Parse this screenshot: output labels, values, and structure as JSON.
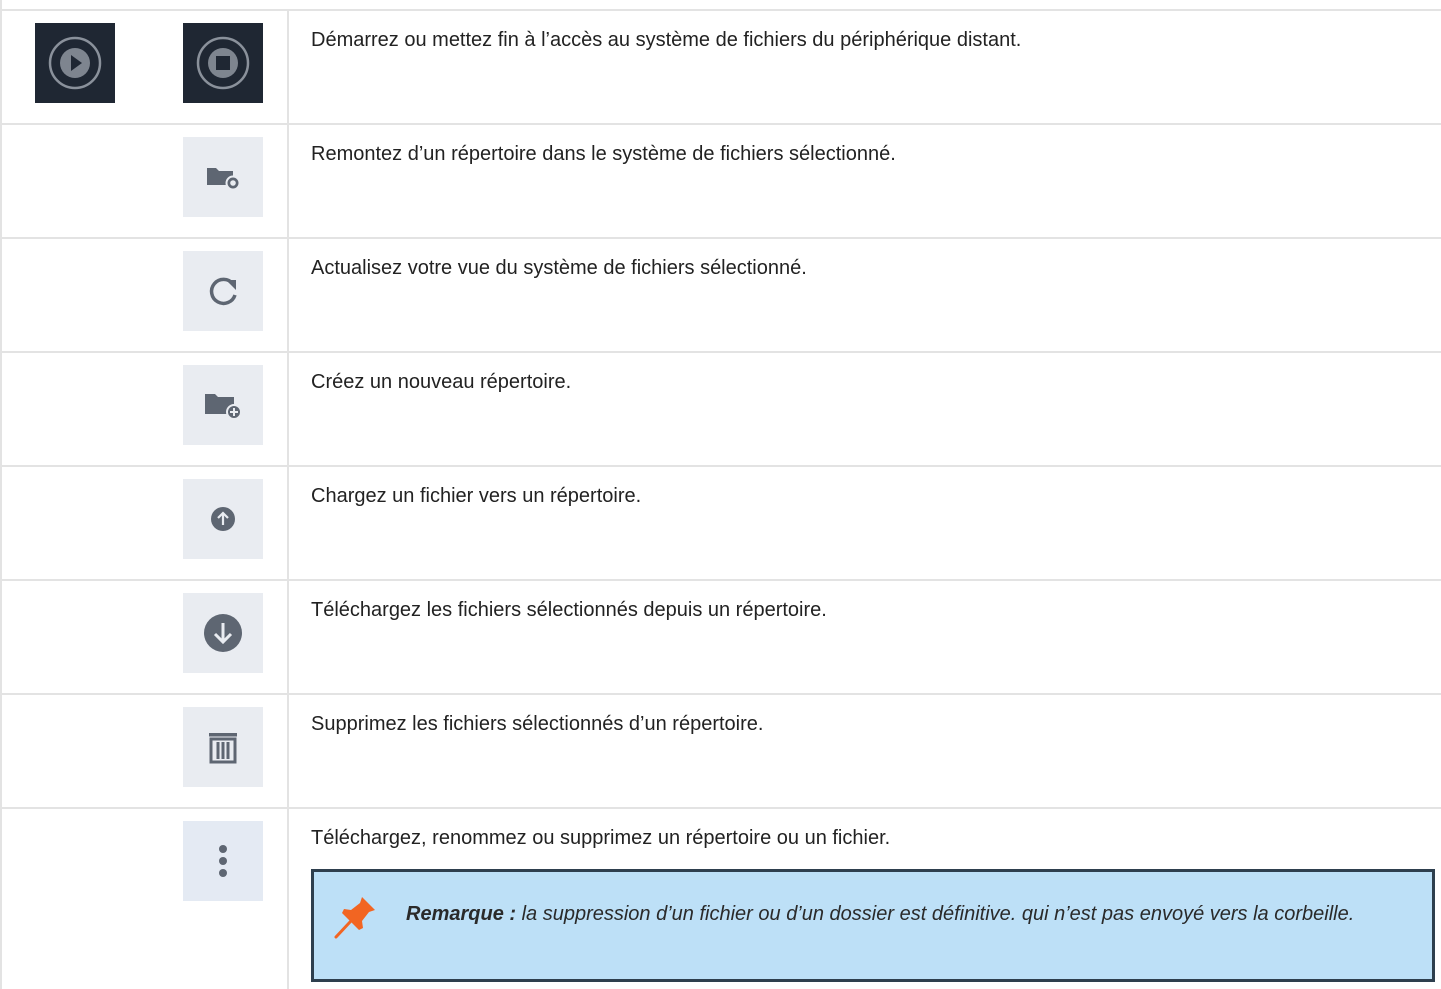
{
  "rows": [
    {
      "icons": [
        "play-circle-icon",
        "stop-circle-icon"
      ],
      "text": "Démarrez ou mettez fin à l’accès au système de fichiers du périphérique distant."
    },
    {
      "icons": [
        "folder-up-icon"
      ],
      "text": "Remontez d’un répertoire dans le système de fichiers sélectionné."
    },
    {
      "icons": [
        "refresh-icon"
      ],
      "text": "Actualisez votre vue du système de fichiers sélectionné."
    },
    {
      "icons": [
        "folder-add-icon"
      ],
      "text": "Créez un nouveau répertoire."
    },
    {
      "icons": [
        "upload-icon"
      ],
      "text": "Chargez un fichier vers un répertoire."
    },
    {
      "icons": [
        "download-icon"
      ],
      "text": "Téléchargez les fichiers sélectionnés depuis un répertoire."
    },
    {
      "icons": [
        "trash-icon"
      ],
      "text": "Supprimez les fichiers sélectionnés d’un répertoire."
    },
    {
      "icons": [
        "more-vertical-icon"
      ],
      "text": "Téléchargez, renommez ou supprimez un répertoire ou un fichier."
    }
  ],
  "note": {
    "icon": "pushpin-icon",
    "label": "Remarque :",
    "text": " la suppression d’un fichier ou d’un dossier est définitive. qui n’est pas envoyé vers la corbeille."
  },
  "colors": {
    "tile_background": "#e9ecf1",
    "dark_tile_background": "#1f2733",
    "icon_gray": "#5e6672",
    "note_background": "#bde0f7",
    "note_border": "#2e3f4e",
    "pushpin": "#f26522"
  }
}
